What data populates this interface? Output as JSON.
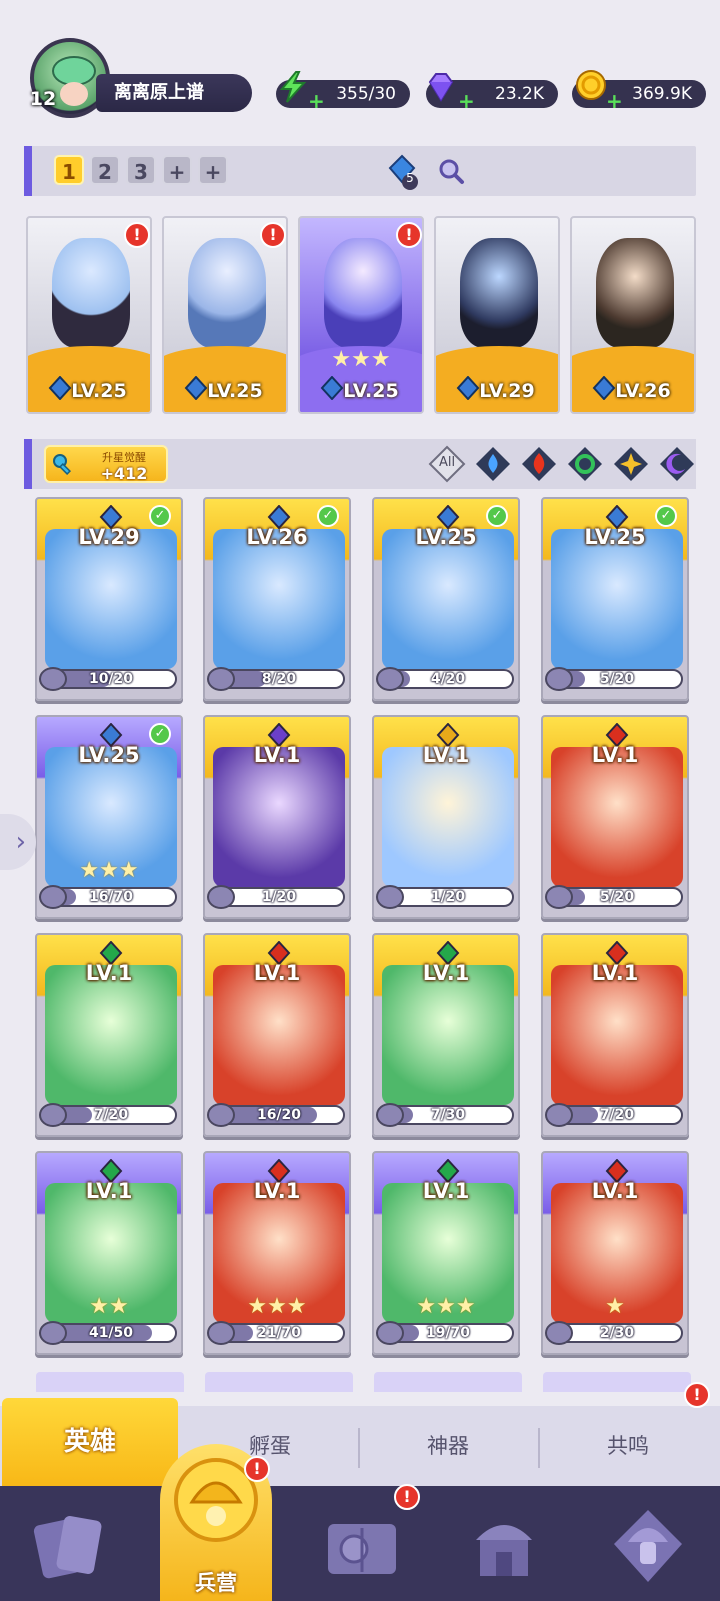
{
  "player": {
    "level": "12",
    "name": "离离原上谱"
  },
  "resources": [
    {
      "name": "energy",
      "icon": "lightning-icon",
      "value": "355/30"
    },
    {
      "name": "gems",
      "icon": "diamond-icon",
      "value": "23.2K"
    },
    {
      "name": "gold",
      "icon": "coin-icon",
      "value": "369.9K"
    }
  ],
  "team_bar": {
    "tabs": [
      "1",
      "2",
      "3",
      "+",
      "+"
    ],
    "active_tab": "1",
    "count_badge": "5"
  },
  "team": [
    {
      "level": "LV.25",
      "alert": "!",
      "theme": "gray",
      "stars": ""
    },
    {
      "level": "LV.25",
      "alert": "!",
      "theme": "gray",
      "stars": ""
    },
    {
      "level": "LV.25",
      "alert": "!",
      "theme": "purple",
      "stars": "★★★"
    },
    {
      "level": "LV.29",
      "alert": "",
      "theme": "gray",
      "stars": ""
    },
    {
      "level": "LV.26",
      "alert": "",
      "theme": "gray",
      "stars": ""
    }
  ],
  "filter_bar": {
    "star_awaken_label": "升星觉醒",
    "star_awaken_value": "+412",
    "filters": [
      "All",
      "water",
      "fire",
      "wind",
      "light",
      "dark"
    ]
  },
  "heroes": [
    {
      "level": "LV.29",
      "element": "water",
      "progress": "10/20",
      "fill": 0.5,
      "theme": "gold",
      "checked": true,
      "stars": ""
    },
    {
      "level": "LV.26",
      "element": "water",
      "progress": "8/20",
      "fill": 0.4,
      "theme": "gold",
      "checked": true,
      "stars": ""
    },
    {
      "level": "LV.25",
      "element": "water",
      "progress": "4/20",
      "fill": 0.2,
      "theme": "gold",
      "checked": true,
      "stars": ""
    },
    {
      "level": "LV.25",
      "element": "water",
      "progress": "5/20",
      "fill": 0.25,
      "theme": "gold",
      "checked": true,
      "stars": ""
    },
    {
      "level": "LV.25",
      "element": "water",
      "progress": "16/70",
      "fill": 0.23,
      "theme": "purple",
      "checked": true,
      "stars": "★★★"
    },
    {
      "level": "LV.1",
      "element": "dark",
      "progress": "1/20",
      "fill": 0.05,
      "theme": "gold",
      "checked": false,
      "stars": ""
    },
    {
      "level": "LV.1",
      "element": "light",
      "progress": "1/20",
      "fill": 0.05,
      "theme": "gold",
      "checked": false,
      "stars": ""
    },
    {
      "level": "LV.1",
      "element": "fire",
      "progress": "5/20",
      "fill": 0.25,
      "theme": "gold",
      "checked": false,
      "stars": ""
    },
    {
      "level": "LV.1",
      "element": "wind",
      "progress": "7/20",
      "fill": 0.35,
      "theme": "gold",
      "checked": false,
      "stars": ""
    },
    {
      "level": "LV.1",
      "element": "fire",
      "progress": "16/20",
      "fill": 0.8,
      "theme": "gold",
      "checked": false,
      "stars": ""
    },
    {
      "level": "LV.1",
      "element": "wind",
      "progress": "7/30",
      "fill": 0.23,
      "theme": "gold",
      "checked": false,
      "stars": ""
    },
    {
      "level": "LV.1",
      "element": "fire",
      "progress": "7/20",
      "fill": 0.35,
      "theme": "gold",
      "checked": false,
      "stars": ""
    },
    {
      "level": "LV.1",
      "element": "wind",
      "progress": "41/50",
      "fill": 0.82,
      "theme": "purple",
      "checked": false,
      "stars": "★★"
    },
    {
      "level": "LV.1",
      "element": "fire",
      "progress": "21/70",
      "fill": 0.3,
      "theme": "purple",
      "checked": false,
      "stars": "★★★"
    },
    {
      "level": "LV.1",
      "element": "wind",
      "progress": "19/70",
      "fill": 0.27,
      "theme": "purple",
      "checked": false,
      "stars": "★★★"
    },
    {
      "level": "LV.1",
      "element": "fire",
      "progress": "2/30",
      "fill": 0.07,
      "theme": "purple",
      "checked": false,
      "stars": "★"
    }
  ],
  "sub_tabs": [
    {
      "label": "英雄",
      "active": true,
      "alert": ""
    },
    {
      "label": "孵蛋",
      "active": false,
      "alert": ""
    },
    {
      "label": "神器",
      "active": false,
      "alert": ""
    },
    {
      "label": "共鸣",
      "active": false,
      "alert": "!"
    }
  ],
  "bottom_nav": [
    {
      "name": "cards",
      "icon": "cards-icon",
      "label": "",
      "alert": ""
    },
    {
      "name": "barracks",
      "icon": "helmet-icon",
      "label": "兵营",
      "alert": "!"
    },
    {
      "name": "adventure",
      "icon": "map-book-icon",
      "label": "",
      "alert": "!"
    },
    {
      "name": "shop",
      "icon": "temple-icon",
      "label": "",
      "alert": ""
    },
    {
      "name": "guild",
      "icon": "mushroom-icon",
      "label": "",
      "alert": ""
    }
  ],
  "colors": {
    "water": "#3a7bd5",
    "fire": "#d92f1e",
    "wind": "#24a84a",
    "light": "#e8a91a",
    "dark": "#6b3fc9",
    "gold_card": "#f6c12a",
    "purple_card": "#8e70ee",
    "alert": "#e6352b"
  }
}
